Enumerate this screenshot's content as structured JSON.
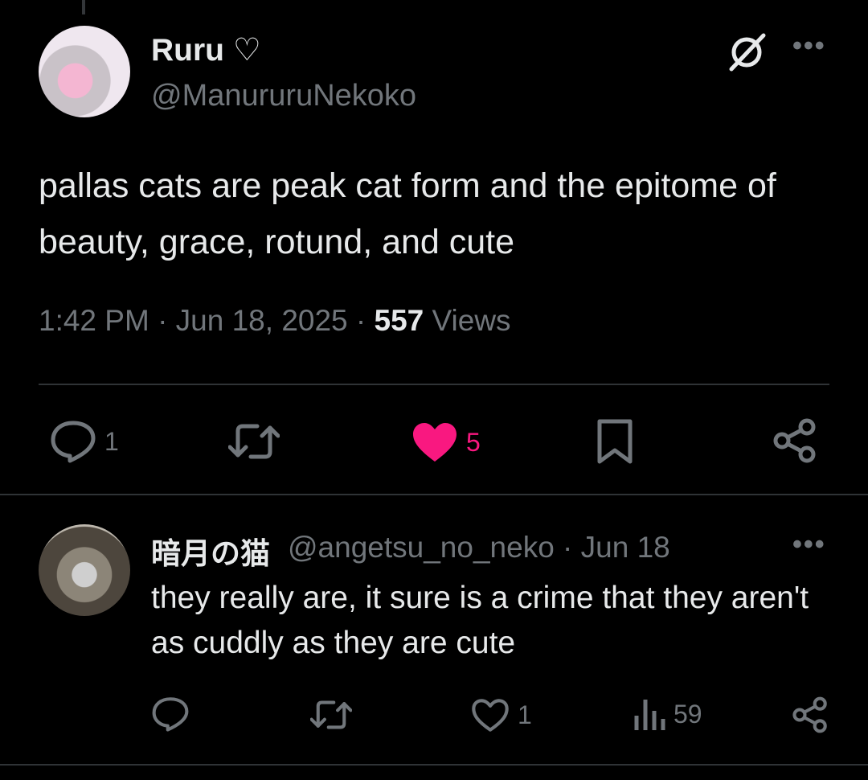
{
  "tweet": {
    "author_name": "Ruru ♡",
    "author_handle": "@ManururuNekoko",
    "text": "pallas cats are peak cat form and the epitome of beauty, grace, rotund, and cute",
    "time": "1:42 PM · Jun 18, 2025 · ",
    "views_count": "557",
    "views_label": " Views",
    "actions": {
      "reply_count": "1",
      "like_count": "5"
    },
    "like_color": "#f91880"
  },
  "reply": {
    "author_name": "暗月の猫",
    "meta": "@angetsu_no_neko · Jun 18",
    "text": "they really are, it sure is a crime that they aren't as cuddly as they are cute",
    "actions": {
      "like_count": "1",
      "views_count": "59"
    }
  },
  "icons": [
    "grok-icon",
    "more-icon",
    "reply-icon",
    "retweet-icon",
    "heart-icon",
    "bookmark-icon",
    "share-icon",
    "views-icon"
  ]
}
